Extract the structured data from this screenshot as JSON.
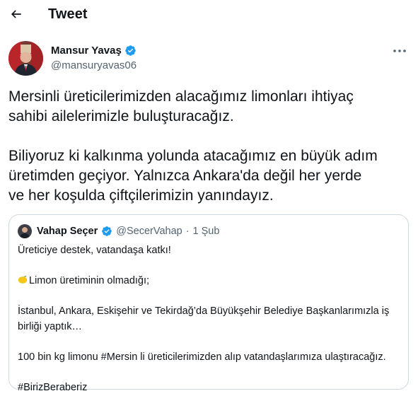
{
  "header": {
    "title": "Tweet",
    "back_icon": "arrow-left-icon"
  },
  "author": {
    "name": "Mansur Yavaş",
    "handle": "@mansuryavas06",
    "verified_icon": "verified-badge-icon",
    "more_icon": "more-horizontal-icon"
  },
  "tweet": {
    "lines": [
      "Mersinli üreticilerimizden alacağımız limonları ihtiyaç",
      "sahibi ailelerimizle buluşturacağız.",
      "Biliyoruz ki kalkınma yolunda atacağımız en büyük adım",
      "üretimden geçiyor. Yalnızca Ankara'da değil her yerde",
      "ve her koşulda çiftçilerimizin yanındayız."
    ]
  },
  "quote": {
    "name": "Vahap Seçer",
    "handle": "@SecerVahap",
    "separator": "·",
    "date": "1 Şub",
    "lines": [
      "Üreticiye destek, vatandaşa katkı!",
      "Limon üretiminin olmadığı;",
      "İstanbul, Ankara, Eskişehir ve Tekirdağ’da Büyükşehir Belediye Başkanlarımızla iş",
      "birliği yaptık…",
      "100 bin kg limonu #Mersin li üreticilerimizden alıp vatandaşlarımıza ulaştıracağız.",
      "#BirizBeraberiz"
    ]
  },
  "colors": {
    "text": "#0f1419",
    "secondary": "#536471",
    "verified": "#1d9bf0",
    "border": "#cfd9de"
  }
}
